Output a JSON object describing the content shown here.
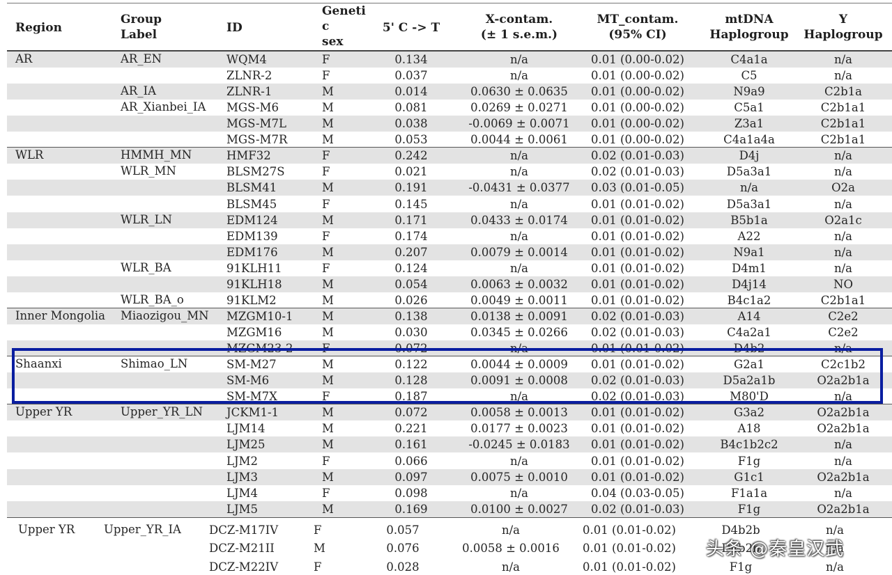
{
  "headers": {
    "region": "Region",
    "group_label_1": "Group",
    "group_label_2": "Label",
    "id": "ID",
    "sex_1": "Geneti",
    "sex_2": "c",
    "sex_3": "sex",
    "ct": "5' C -> T",
    "x_contam_1": "X-contam.",
    "x_contam_2": "(± 1 s.e.m.)",
    "mt_contam_1": "MT_contam.",
    "mt_contam_2": "(95% CI)",
    "mtdna_1": "mtDNA",
    "mtdna_2": "Haplogroup",
    "y_1": "Y",
    "y_2": "Haplogroup"
  },
  "regions": [
    {
      "label": "AR",
      "row": 0
    },
    {
      "label": "WLR",
      "row": 6
    },
    {
      "label": "Inner Mongolia",
      "row": 16
    },
    {
      "label": "Shaanxi",
      "row": 19
    },
    {
      "label": "Upper YR",
      "row": 22
    },
    {
      "label": "Upper YR",
      "row": 29
    }
  ],
  "groups": [
    {
      "label": "AR_EN",
      "row": 0
    },
    {
      "label": "AR_IA",
      "row": 2
    },
    {
      "label": "AR_Xianbei_IA",
      "row": 3
    },
    {
      "label": "HMMH_MN",
      "row": 6
    },
    {
      "label": "WLR_MN",
      "row": 7
    },
    {
      "label": "WLR_LN",
      "row": 10
    },
    {
      "label": "WLR_BA",
      "row": 13
    },
    {
      "label": "WLR_BA_o",
      "row": 15
    },
    {
      "label": "Miaozigou_MN",
      "row": 16
    },
    {
      "label": "Shimao_LN",
      "row": 19
    },
    {
      "label": "Upper_YR_LN",
      "row": 22
    },
    {
      "label": "Upper_YR_IA",
      "row": 29
    }
  ],
  "rows": [
    {
      "id": "WQM4",
      "sex": "F",
      "ct": "0.134",
      "x": "n/a",
      "mt": "0.01 (0.00-0.02)",
      "mtdna": "C4a1a",
      "y": "n/a"
    },
    {
      "id": "ZLNR-2",
      "sex": "F",
      "ct": "0.037",
      "x": "n/a",
      "mt": "0.01 (0.00-0.02)",
      "mtdna": "C5",
      "y": "n/a"
    },
    {
      "id": "ZLNR-1",
      "sex": "M",
      "ct": "0.014",
      "x": "0.0630 ± 0.0635",
      "mt": "0.01 (0.00-0.02)",
      "mtdna": "N9a9",
      "y": "C2b1a"
    },
    {
      "id": "MGS-M6",
      "sex": "M",
      "ct": "0.081",
      "x": "0.0269 ± 0.0271",
      "mt": "0.01 (0.00-0.02)",
      "mtdna": "C5a1",
      "y": "C2b1a1"
    },
    {
      "id": "MGS-M7L",
      "sex": "M",
      "ct": "0.038",
      "x": "-0.0069 ± 0.0071",
      "mt": "0.01 (0.00-0.02)",
      "mtdna": "Z3a1",
      "y": "C2b1a1"
    },
    {
      "id": "MGS-M7R",
      "sex": "M",
      "ct": "0.053",
      "x": "0.0044 ± 0.0061",
      "mt": "0.01 (0.00-0.02)",
      "mtdna": "C4a1a4a",
      "y": "C2b1a1"
    },
    {
      "id": "HMF32",
      "sex": "F",
      "ct": "0.242",
      "x": "n/a",
      "mt": "0.02 (0.01-0.03)",
      "mtdna": "D4j",
      "y": "n/a"
    },
    {
      "id": "BLSM27S",
      "sex": "F",
      "ct": "0.021",
      "x": "n/a",
      "mt": "0.02 (0.01-0.03)",
      "mtdna": "D5a3a1",
      "y": "n/a"
    },
    {
      "id": "BLSM41",
      "sex": "M",
      "ct": "0.191",
      "x": "-0.0431 ± 0.0377",
      "mt": "0.03 (0.01-0.05)",
      "mtdna": "n/a",
      "y": "O2a"
    },
    {
      "id": "BLSM45",
      "sex": "F",
      "ct": "0.145",
      "x": "n/a",
      "mt": "0.01 (0.01-0.02)",
      "mtdna": "D5a3a1",
      "y": "n/a"
    },
    {
      "id": "EDM124",
      "sex": "M",
      "ct": "0.171",
      "x": "0.0433 ± 0.0174",
      "mt": "0.01 (0.01-0.02)",
      "mtdna": "B5b1a",
      "y": "O2a1c"
    },
    {
      "id": "EDM139",
      "sex": "F",
      "ct": "0.174",
      "x": "n/a",
      "mt": "0.01 (0.01-0.02)",
      "mtdna": "A22",
      "y": "n/a"
    },
    {
      "id": "EDM176",
      "sex": "M",
      "ct": "0.207",
      "x": "0.0079 ± 0.0014",
      "mt": "0.01 (0.01-0.02)",
      "mtdna": "N9a1",
      "y": "n/a"
    },
    {
      "id": "91KLH11",
      "sex": "F",
      "ct": "0.124",
      "x": "n/a",
      "mt": "0.01 (0.01-0.02)",
      "mtdna": "D4m1",
      "y": "n/a"
    },
    {
      "id": "91KLH18",
      "sex": "M",
      "ct": "0.054",
      "x": "0.0063 ± 0.0032",
      "mt": "0.01 (0.01-0.02)",
      "mtdna": "D4j14",
      "y": "NO"
    },
    {
      "id": "91KLM2",
      "sex": "M",
      "ct": "0.026",
      "x": "0.0049 ± 0.0011",
      "mt": "0.01 (0.01-0.02)",
      "mtdna": "B4c1a2",
      "y": "C2b1a1"
    },
    {
      "id": "MZGM10-1",
      "sex": "M",
      "ct": "0.138",
      "x": "0.0138 ± 0.0091",
      "mt": "0.02 (0.01-0.03)",
      "mtdna": "A14",
      "y": "C2e2"
    },
    {
      "id": "MZGM16",
      "sex": "M",
      "ct": "0.030",
      "x": "0.0345 ± 0.0266",
      "mt": "0.02 (0.01-0.03)",
      "mtdna": "C4a2a1",
      "y": "C2e2"
    },
    {
      "id": "MZGM23-2",
      "sex": "F",
      "ct": "0.072",
      "x": "n/a",
      "mt": "0.01 (0.01-0.02)",
      "mtdna": "D4b2",
      "y": "n/a"
    },
    {
      "id": "SM-M27",
      "sex": "M",
      "ct": "0.122",
      "x": "0.0044 ± 0.0009",
      "mt": "0.01 (0.01-0.02)",
      "mtdna": "G2a1",
      "y": "C2c1b2"
    },
    {
      "id": "SM-M6",
      "sex": "M",
      "ct": "0.128",
      "x": "0.0091 ± 0.0008",
      "mt": "0.02 (0.01-0.03)",
      "mtdna": "D5a2a1b",
      "y": "O2a2b1a"
    },
    {
      "id": "SM-M7X",
      "sex": "F",
      "ct": "0.187",
      "x": "n/a",
      "mt": "0.02 (0.01-0.03)",
      "mtdna": "M80'D",
      "y": "n/a"
    },
    {
      "id": "JCKM1-1",
      "sex": "M",
      "ct": "0.072",
      "x": "0.0058 ± 0.0013",
      "mt": "0.01 (0.01-0.02)",
      "mtdna": "G3a2",
      "y": "O2a2b1a"
    },
    {
      "id": "LJM14",
      "sex": "M",
      "ct": "0.221",
      "x": "0.0177 ± 0.0023",
      "mt": "0.01 (0.01-0.02)",
      "mtdna": "A18",
      "y": "O2a2b1a"
    },
    {
      "id": "LJM25",
      "sex": "M",
      "ct": "0.161",
      "x": "-0.0245 ± 0.0183",
      "mt": "0.01 (0.01-0.02)",
      "mtdna": "B4c1b2c2",
      "y": "n/a"
    },
    {
      "id": "LJM2",
      "sex": "F",
      "ct": "0.066",
      "x": "n/a",
      "mt": "0.01 (0.01-0.02)",
      "mtdna": "F1g",
      "y": "n/a"
    },
    {
      "id": "LJM3",
      "sex": "M",
      "ct": "0.097",
      "x": "0.0075 ± 0.0010",
      "mt": "0.01 (0.01-0.02)",
      "mtdna": "G1c1",
      "y": "O2a2b1a"
    },
    {
      "id": "LJM4",
      "sex": "F",
      "ct": "0.098",
      "x": "n/a",
      "mt": "0.04 (0.03-0.05)",
      "mtdna": "F1a1a",
      "y": "n/a"
    },
    {
      "id": "LJM5",
      "sex": "M",
      "ct": "0.169",
      "x": "0.0100 ± 0.0027",
      "mt": "0.02 (0.01-0.03)",
      "mtdna": "F1g",
      "y": "O2a2b1a"
    },
    {
      "id": "DCZ-M17IV",
      "sex": "F",
      "ct": "0.057",
      "x": "n/a",
      "mt": "0.01 (0.01-0.02)",
      "mtdna": "D4b2b",
      "y": "n/a"
    },
    {
      "id": "DCZ-M21II",
      "sex": "M",
      "ct": "0.076",
      "x": "0.0058 ± 0.0016",
      "mt": "0.01 (0.01-0.02)",
      "mtdna": "D4b2b",
      "y": "n/a"
    },
    {
      "id": "DCZ-M22IV",
      "sex": "F",
      "ct": "0.028",
      "x": "n/a",
      "mt": "0.01 (0.01-0.02)",
      "mtdna": "F1g",
      "y": "n/a"
    }
  ],
  "watermark": "头条 @秦皇汉武",
  "colors": {
    "highlight_box": "#0a1ea0",
    "row_shade": "#e3e3e3"
  }
}
